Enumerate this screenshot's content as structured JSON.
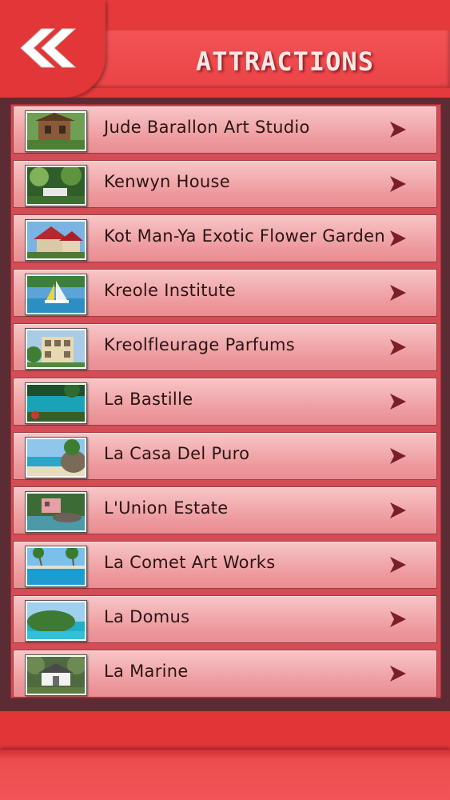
{
  "header": {
    "title": "ATTRACTIONS",
    "back_icon": "double-chevron-left-icon"
  },
  "colors": {
    "accent": "#e53a3c",
    "panel": "#5b2c34",
    "item_top": "#f7c6c7",
    "item_bottom": "#e98d91",
    "arrow": "#7a1f2a"
  },
  "items": [
    {
      "label": "Jude Barallon Art Studio",
      "thumb": "house-garden"
    },
    {
      "label": "Kenwyn House",
      "thumb": "garden"
    },
    {
      "label": "Kot Man-Ya Exotic Flower Garden",
      "thumb": "red-roof-house"
    },
    {
      "label": "Kreole Institute",
      "thumb": "sailboat"
    },
    {
      "label": "Kreolfleurage Parfums",
      "thumb": "villa"
    },
    {
      "label": "La Bastille",
      "thumb": "lagoon"
    },
    {
      "label": "La Casa Del Puro",
      "thumb": "beach-rocks"
    },
    {
      "label": "L'Union Estate",
      "thumb": "coast-house"
    },
    {
      "label": "La Comet Art Works",
      "thumb": "pool"
    },
    {
      "label": "La Domus",
      "thumb": "island"
    },
    {
      "label": "La Marine",
      "thumb": "white-house"
    }
  ]
}
